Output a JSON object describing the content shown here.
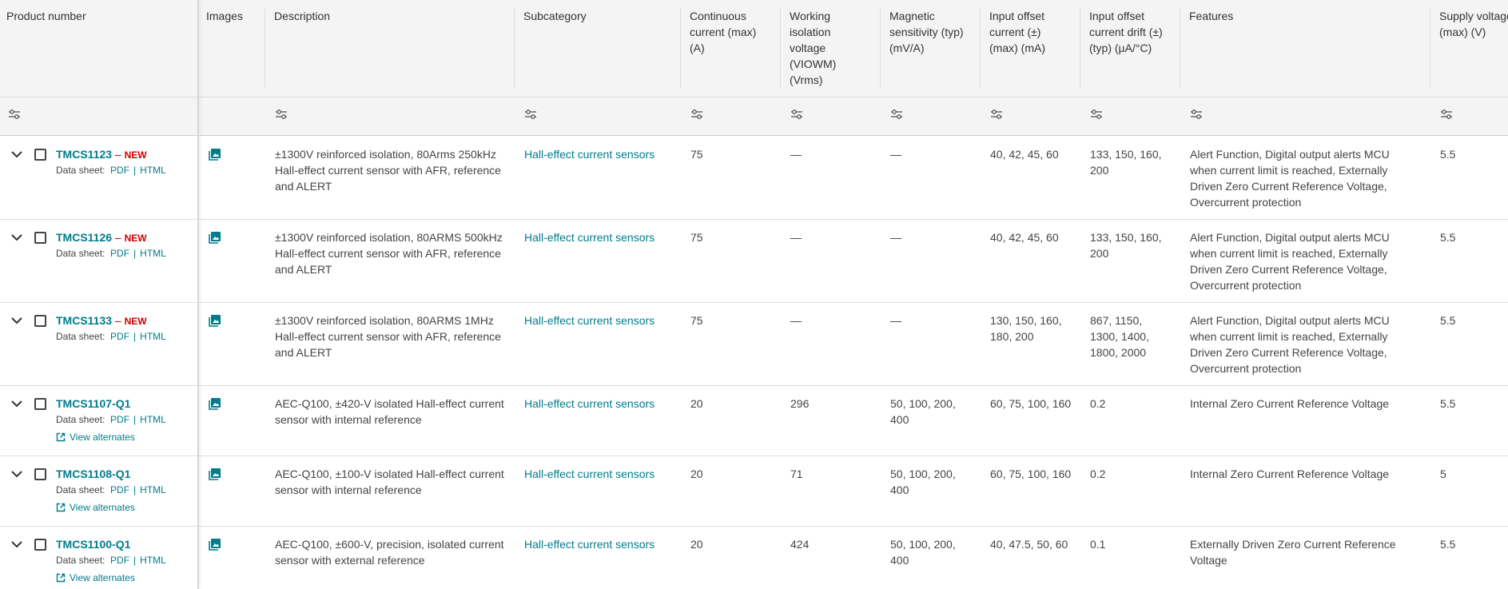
{
  "columns": {
    "product_number": "Product number",
    "images": "Images",
    "description": "Description",
    "subcategory": "Subcategory",
    "continuous_current": [
      "Continuous",
      "current (max)",
      "(A)"
    ],
    "working_isolation": [
      "Working",
      "isolation",
      "voltage",
      "(VIOWM)",
      "(Vrms)"
    ],
    "magnetic_sensitivity": [
      "Magnetic",
      "sensitivity (typ)",
      "(mV/A)"
    ],
    "input_offset_current": [
      "Input offset",
      "current (±)",
      "(max) (mA)"
    ],
    "input_offset_drift": [
      "Input offset",
      "current drift (±)",
      "(typ) (µA/°C)"
    ],
    "features": "Features",
    "supply_voltage": [
      "Supply voltage",
      "(max) (V)"
    ]
  },
  "labels": {
    "datasheet": "Data sheet:",
    "pdf": "PDF",
    "html": "HTML",
    "pipe": "|",
    "view_alternates": "View alternates",
    "dash": " – ",
    "new": "NEW"
  },
  "icons": {
    "expand": "chevron-down-icon",
    "select": "checkbox-icon",
    "image": "image-icon",
    "filter": "filter-sliders-icon",
    "external": "external-link-icon"
  },
  "colors": {
    "link": "#007c8c",
    "new_badge": "#cc0000",
    "header_bg": "#f4f4f4"
  },
  "rows": [
    {
      "product": "TMCS1123",
      "is_new": true,
      "has_alternates": false,
      "description": [
        "±1300V reinforced isolation, 80Arms 250kHz",
        "Hall-effect current sensor with AFR, reference",
        "and ALERT"
      ],
      "subcategory": "Hall-effect current sensors",
      "continuous_current": "75",
      "working_isolation": "—",
      "magnetic_sensitivity": [
        "—"
      ],
      "input_offset_current": [
        "40, 42, 45, 60"
      ],
      "input_offset_drift": [
        "133, 150, 160,",
        "200"
      ],
      "features": [
        "Alert Function, Digital output alerts MCU",
        "when current limit is reached, Externally",
        "Driven Zero Current Reference Voltage,",
        "Overcurrent protection"
      ],
      "supply_voltage": "5.5"
    },
    {
      "product": "TMCS1126",
      "is_new": true,
      "has_alternates": false,
      "description": [
        "±1300V reinforced isolation, 80ARMS 500kHz",
        "Hall-effect current sensor with AFR, reference",
        "and ALERT"
      ],
      "subcategory": "Hall-effect current sensors",
      "continuous_current": "75",
      "working_isolation": "—",
      "magnetic_sensitivity": [
        "—"
      ],
      "input_offset_current": [
        "40, 42, 45, 60"
      ],
      "input_offset_drift": [
        "133, 150, 160,",
        "200"
      ],
      "features": [
        "Alert Function, Digital output alerts MCU",
        "when current limit is reached, Externally",
        "Driven Zero Current Reference Voltage,",
        "Overcurrent protection"
      ],
      "supply_voltage": "5.5"
    },
    {
      "product": "TMCS1133",
      "is_new": true,
      "has_alternates": false,
      "description": [
        "±1300V reinforced isolation, 80ARMS 1MHz",
        "Hall-effect current sensor with AFR, reference",
        "and ALERT"
      ],
      "subcategory": "Hall-effect current sensors",
      "continuous_current": "75",
      "working_isolation": "—",
      "magnetic_sensitivity": [
        "—"
      ],
      "input_offset_current": [
        "130, 150, 160,",
        "180, 200"
      ],
      "input_offset_drift": [
        "867, 1150,",
        "1300, 1400,",
        "1800, 2000"
      ],
      "features": [
        "Alert Function, Digital output alerts MCU",
        "when current limit is reached, Externally",
        "Driven Zero Current Reference Voltage,",
        "Overcurrent protection"
      ],
      "supply_voltage": "5.5"
    },
    {
      "product": "TMCS1107-Q1",
      "is_new": false,
      "has_alternates": true,
      "description": [
        "AEC-Q100, ±420-V isolated Hall-effect current",
        "sensor with internal reference"
      ],
      "subcategory": "Hall-effect current sensors",
      "continuous_current": "20",
      "working_isolation": "296",
      "magnetic_sensitivity": [
        "50, 100, 200,",
        "400"
      ],
      "input_offset_current": [
        "60, 75, 100, 160"
      ],
      "input_offset_drift": [
        "0.2"
      ],
      "features": [
        "Internal Zero Current Reference Voltage"
      ],
      "supply_voltage": "5.5"
    },
    {
      "product": "TMCS1108-Q1",
      "is_new": false,
      "has_alternates": true,
      "description": [
        "AEC-Q100, ±100-V isolated Hall-effect current",
        "sensor with internal reference"
      ],
      "subcategory": "Hall-effect current sensors",
      "continuous_current": "20",
      "working_isolation": "71",
      "magnetic_sensitivity": [
        "50, 100, 200,",
        "400"
      ],
      "input_offset_current": [
        "60, 75, 100, 160"
      ],
      "input_offset_drift": [
        "0.2"
      ],
      "features": [
        "Internal Zero Current Reference Voltage"
      ],
      "supply_voltage": "5"
    },
    {
      "product": "TMCS1100-Q1",
      "is_new": false,
      "has_alternates": true,
      "description": [
        "AEC-Q100, ±600-V, precision, isolated current",
        "sensor with external reference"
      ],
      "subcategory": "Hall-effect current sensors",
      "continuous_current": "20",
      "working_isolation": "424",
      "magnetic_sensitivity": [
        "50, 100, 200,",
        "400"
      ],
      "input_offset_current": [
        "40, 47.5, 50, 60"
      ],
      "input_offset_drift": [
        "0.1"
      ],
      "features": [
        "Externally Driven Zero Current Reference",
        "Voltage"
      ],
      "supply_voltage": "5.5"
    }
  ]
}
